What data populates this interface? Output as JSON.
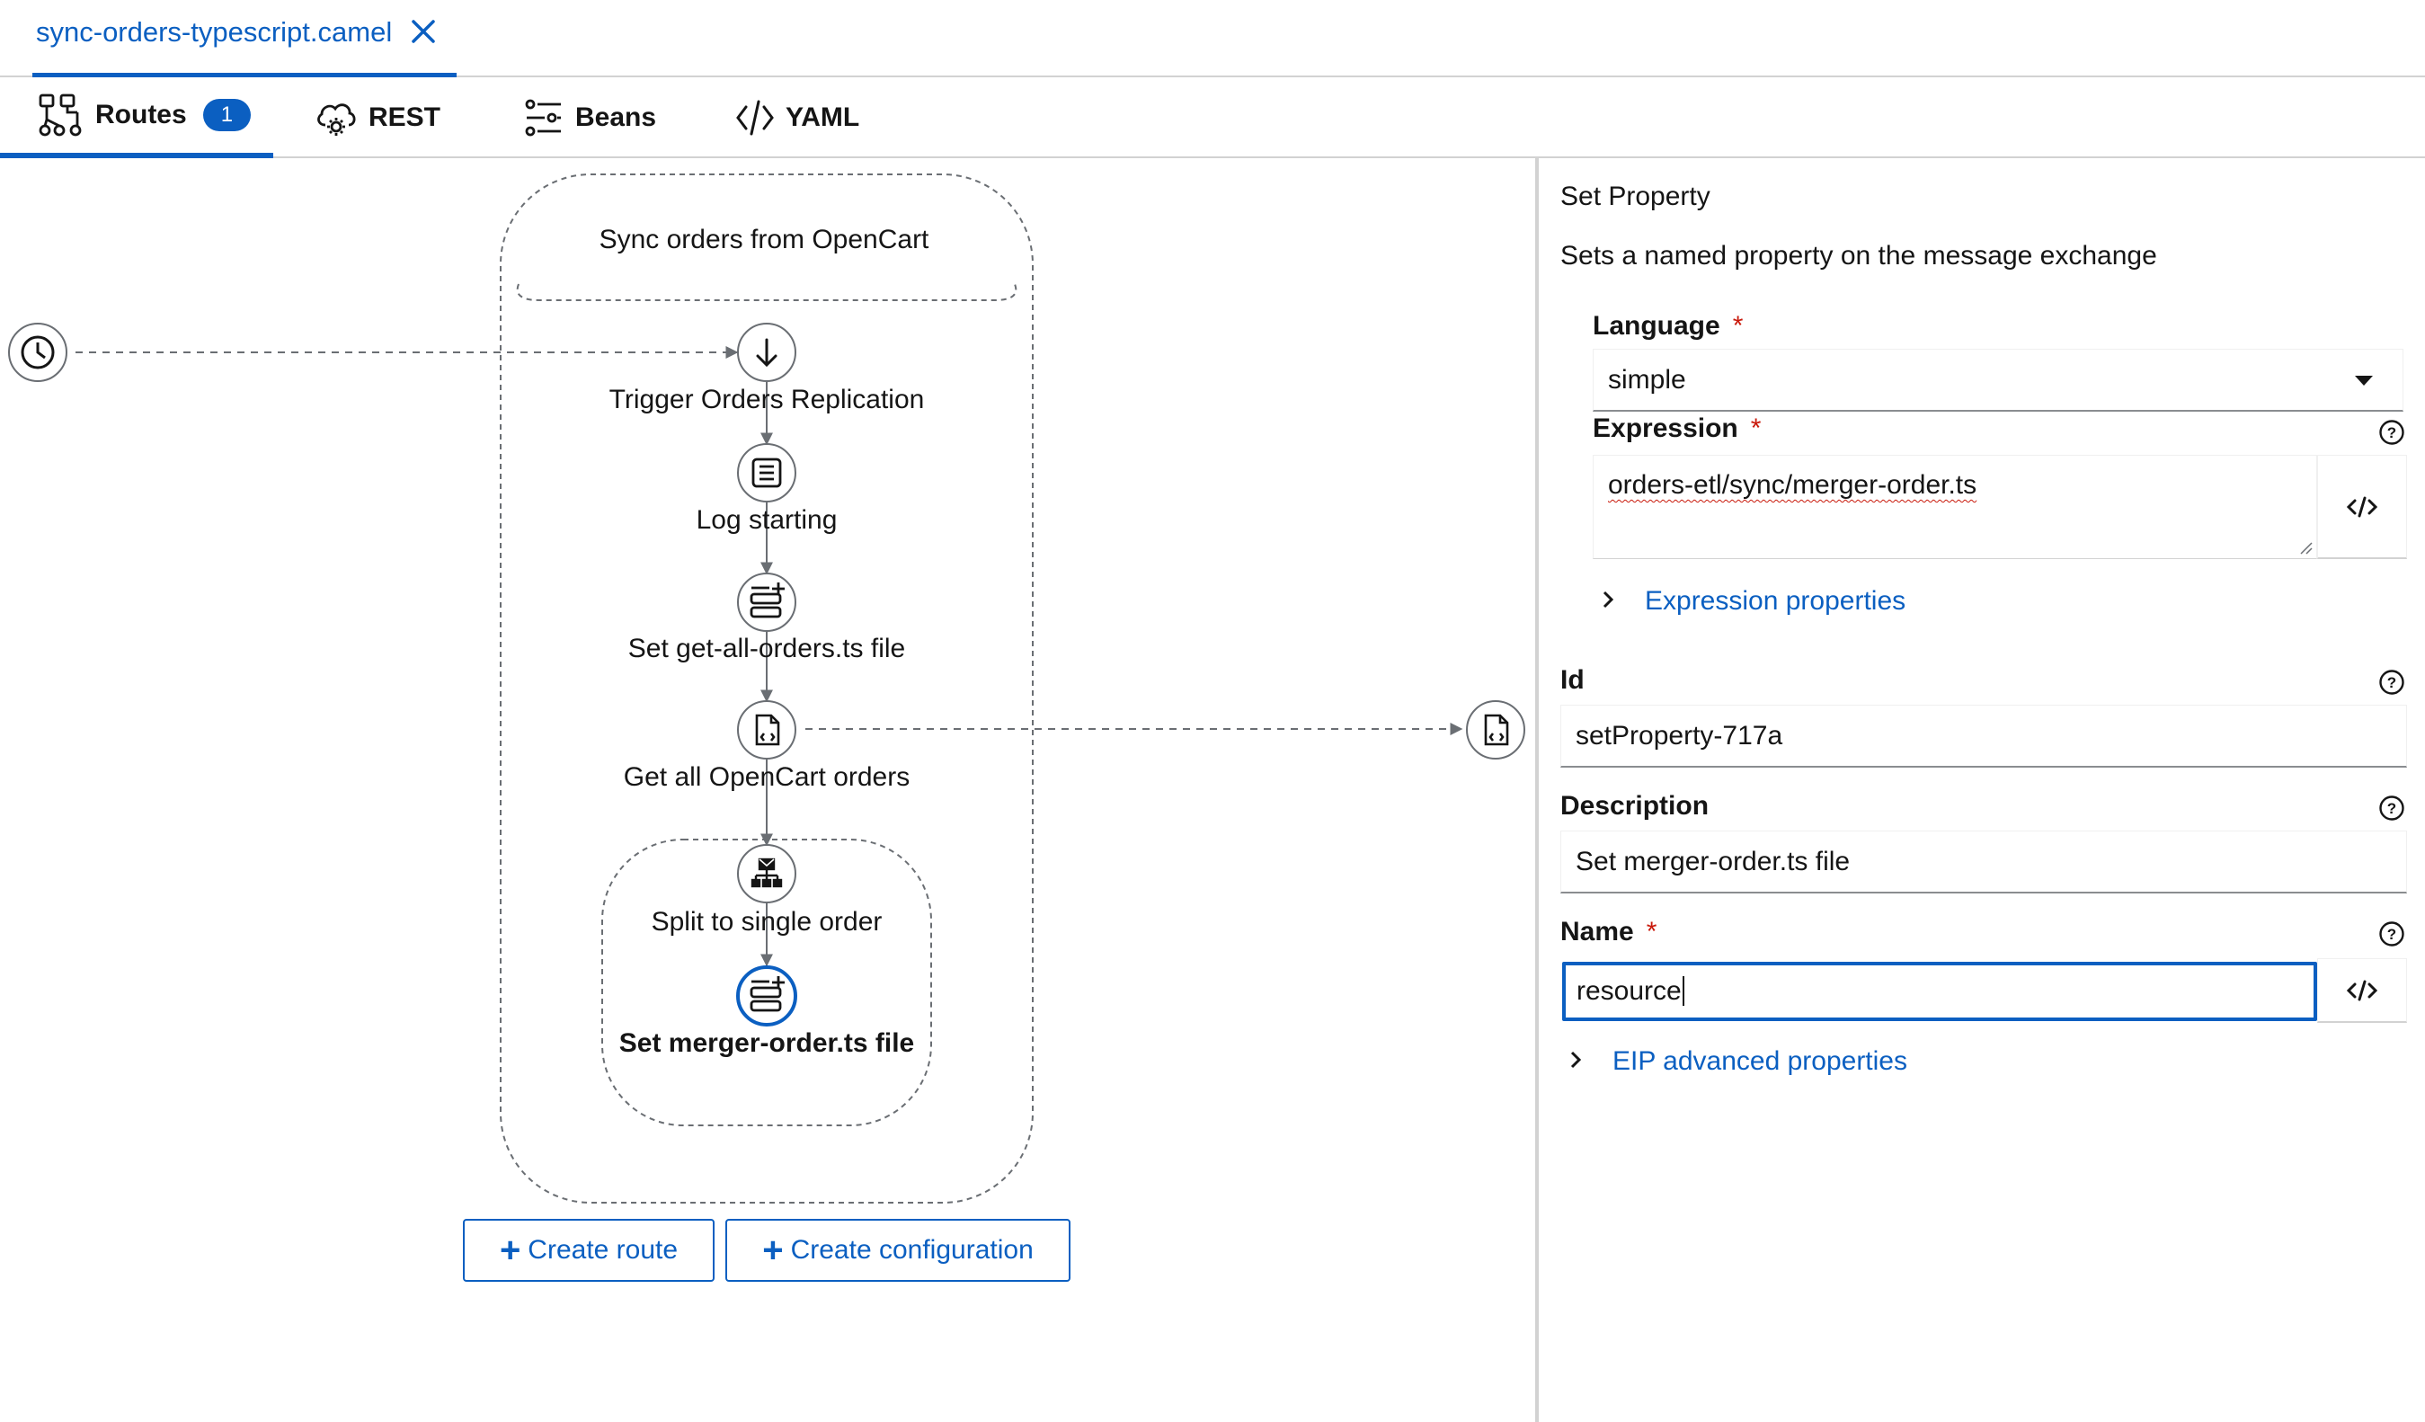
{
  "file_tab": {
    "name": "sync-orders-typescript.camel"
  },
  "view_tabs": [
    {
      "label": "Routes",
      "badge": "1",
      "icon": "routes-icon",
      "active": true
    },
    {
      "label": "REST",
      "icon": "cloud-gear-icon"
    },
    {
      "label": "Beans",
      "icon": "sliders-icon"
    },
    {
      "label": "YAML",
      "icon": "code-icon"
    }
  ],
  "canvas": {
    "route_title": "Sync orders from OpenCart",
    "nodes": [
      {
        "label": "Trigger Orders Replication",
        "icon": "arrow-down-icon"
      },
      {
        "label": "Log starting",
        "icon": "log-icon"
      },
      {
        "label": "Set get-all-orders.ts file",
        "icon": "set-property-icon"
      },
      {
        "label": "Get all OpenCart orders",
        "icon": "code-file-icon"
      },
      {
        "label": "Split to single order",
        "icon": "split-icon"
      },
      {
        "label": "Set merger-order.ts file",
        "icon": "set-property-icon",
        "selected": true
      }
    ],
    "external_nodes": [
      {
        "icon": "clock-icon"
      },
      {
        "icon": "code-file-icon"
      }
    ],
    "buttons": {
      "create_route": "Create route",
      "create_configuration": "Create configuration"
    }
  },
  "panel": {
    "title": "Set Property",
    "description": "Sets a named property on the message exchange",
    "language": {
      "label": "Language",
      "required": "*",
      "value": "simple"
    },
    "expression": {
      "label": "Expression",
      "required": "*",
      "value": "orders-etl/sync/merger-order.ts"
    },
    "expression_properties": "Expression properties",
    "id": {
      "label": "Id",
      "value": "setProperty-717a"
    },
    "description_field": {
      "label": "Description",
      "value": "Set merger-order.ts file"
    },
    "name": {
      "label": "Name",
      "required": "*",
      "value": "resource"
    },
    "eip_advanced": "EIP advanced properties"
  },
  "colors": {
    "accent": "#0b5fc1",
    "required": "#c9190b",
    "border": "#d2d2d2"
  }
}
